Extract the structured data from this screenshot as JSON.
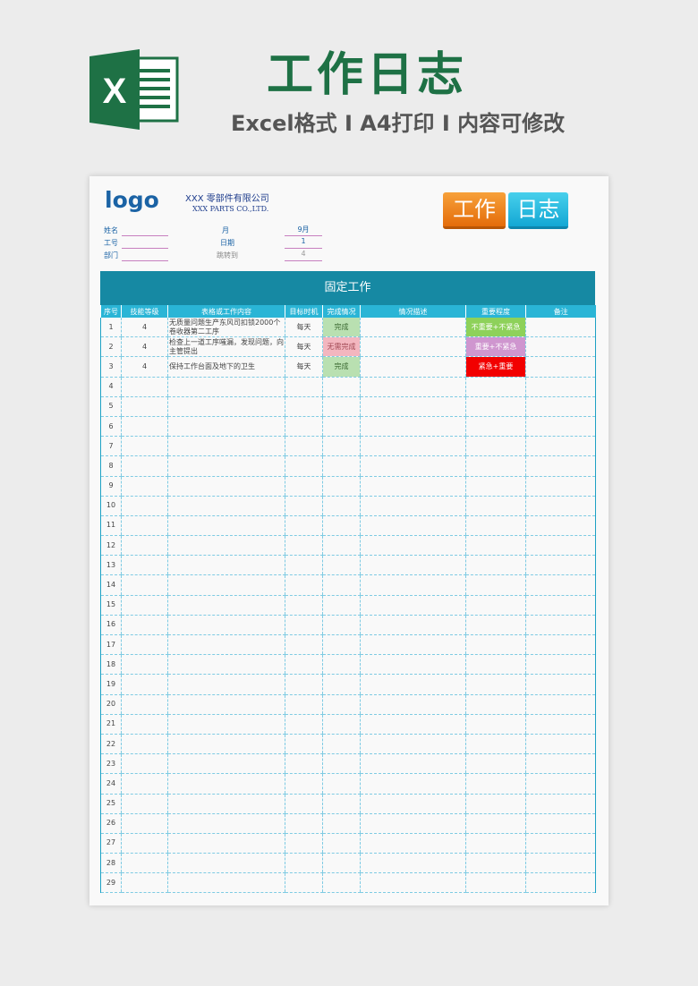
{
  "banner": {
    "title": "工作日志",
    "subtitle": "Excel格式 I A4打印 I 内容可修改",
    "icon": "excel-icon",
    "icon_letter": "X"
  },
  "header": {
    "logo": "logo",
    "company_cn": "XXX 零部件有限公司",
    "company_en": "XXX PARTS CO.,LTD.",
    "badge_work": "工作",
    "badge_log": "日志",
    "fields": [
      {
        "label": "姓名",
        "value": ""
      },
      {
        "label": "工号",
        "value": ""
      },
      {
        "label": "部门",
        "value": ""
      }
    ],
    "date_fields": [
      {
        "label": "月",
        "value": "9月"
      },
      {
        "label": "日期",
        "value": "1"
      },
      {
        "label": "跳转到",
        "value": "4"
      }
    ]
  },
  "section_title": "固定工作",
  "columns": [
    "序号",
    "技能等级",
    "表格或工作内容",
    "目标时机",
    "完成情况",
    "情况描述",
    "重要程度",
    "备注"
  ],
  "rows": [
    {
      "no": "1",
      "level": "4",
      "content": "无质量问题生产东风司扣锁2000个卷收器第二工序",
      "timing": "每天",
      "status": "完成",
      "desc": "",
      "priority": "不重要+不紧急",
      "note": ""
    },
    {
      "no": "2",
      "level": "4",
      "content": "检查上一道工序嗤漏，发现问题，向主管提出",
      "timing": "每天",
      "status": "无需完成",
      "desc": "",
      "priority": "重要+不紧急",
      "note": ""
    },
    {
      "no": "3",
      "level": "4",
      "content": "保持工作台面及地下的卫生",
      "timing": "每天",
      "status": "完成",
      "desc": "",
      "priority": "紧急+重要",
      "note": ""
    }
  ],
  "empty_row_numbers": [
    "4",
    "5",
    "6",
    "7",
    "8",
    "9",
    "10",
    "11",
    "12",
    "13",
    "14",
    "15",
    "16",
    "17",
    "18",
    "19",
    "20",
    "21",
    "22",
    "23",
    "24",
    "25",
    "26",
    "27",
    "28",
    "29"
  ],
  "colors": {
    "brand_green": "#1e7145",
    "header_teal": "#1689a3",
    "column_header": "#2ab5d6",
    "status_done": "#b9e0b1",
    "status_not_needed": "#f3b6bf",
    "priority_low": "#8ed15a",
    "priority_mid": "#cf96cf",
    "priority_high": "#f20000"
  }
}
